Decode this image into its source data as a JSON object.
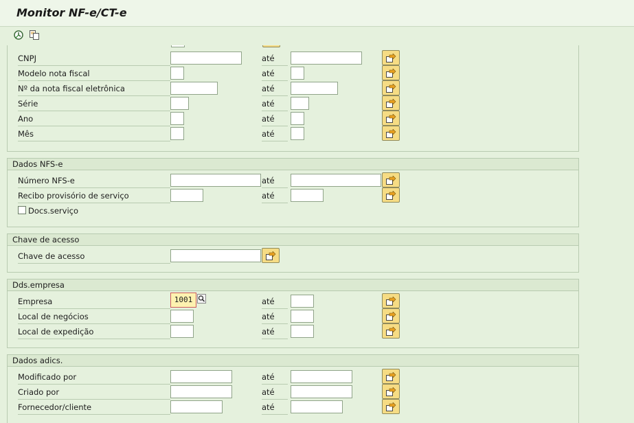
{
  "window": {
    "title": "Monitor NF-e/CT-e"
  },
  "toolbar": {
    "execute_icon": "execute-icon",
    "variant_icon": "get-variant-icon"
  },
  "labels": {
    "ate": "até"
  },
  "groups": {
    "nfe": {
      "rows": [
        {
          "label": "CNPJ"
        },
        {
          "label": "Modelo nota fiscal"
        },
        {
          "label": "Nº da nota fiscal eletrônica"
        },
        {
          "label": "Série"
        },
        {
          "label": "Ano"
        },
        {
          "label": "Mês"
        }
      ]
    },
    "nfse": {
      "title": "Dados NFS-e",
      "rows": [
        {
          "label": "Número NFS-e"
        },
        {
          "label": "Recibo provisório de serviço"
        }
      ],
      "checkbox_label": "Docs.serviço"
    },
    "chave": {
      "title": "Chave de acesso",
      "rows": [
        {
          "label": "Chave de acesso"
        }
      ]
    },
    "empresa": {
      "title": "Dds.empresa",
      "rows": [
        {
          "label": "Empresa",
          "value": "1001"
        },
        {
          "label": "Local de negócios"
        },
        {
          "label": "Local de expedição"
        }
      ]
    },
    "adics": {
      "title": "Dados adics.",
      "rows": [
        {
          "label": "Modificado por"
        },
        {
          "label": "Criado por"
        },
        {
          "label": "Fornecedor/cliente"
        }
      ]
    }
  },
  "colors": {
    "background": "#e5f1dd",
    "select_button": "#f6dc84",
    "required_border": "#cc5a5a"
  }
}
